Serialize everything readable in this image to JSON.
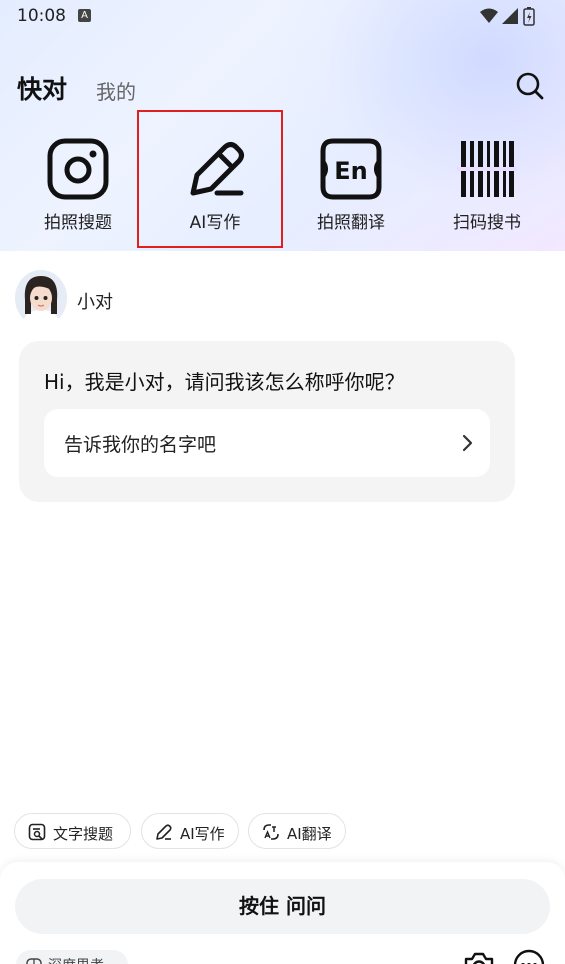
{
  "status": {
    "time": "10:08",
    "notif": "A"
  },
  "header": {
    "tab_main": "快对",
    "tab_mine": "我的"
  },
  "tools": [
    {
      "label": "拍照搜题",
      "icon": "camera-square-icon"
    },
    {
      "label": "AI写作",
      "icon": "pencil-icon"
    },
    {
      "label": "拍照翻译",
      "icon": "en-translate-icon"
    },
    {
      "label": "扫码搜书",
      "icon": "barcode-icon"
    }
  ],
  "bot": {
    "name": "小对"
  },
  "chat": {
    "message": "Hi，我是小对，请问我该怎么称呼你呢？",
    "suggestion": "告诉我你的名字吧"
  },
  "chips": [
    {
      "label": "文字搜题",
      "icon": "text-search-icon"
    },
    {
      "label": "AI写作",
      "icon": "pencil-icon"
    },
    {
      "label": "AI翻译",
      "icon": "translate-icon"
    }
  ],
  "input": {
    "hold_label": "按住 问问",
    "deep_label": "深度思考"
  }
}
